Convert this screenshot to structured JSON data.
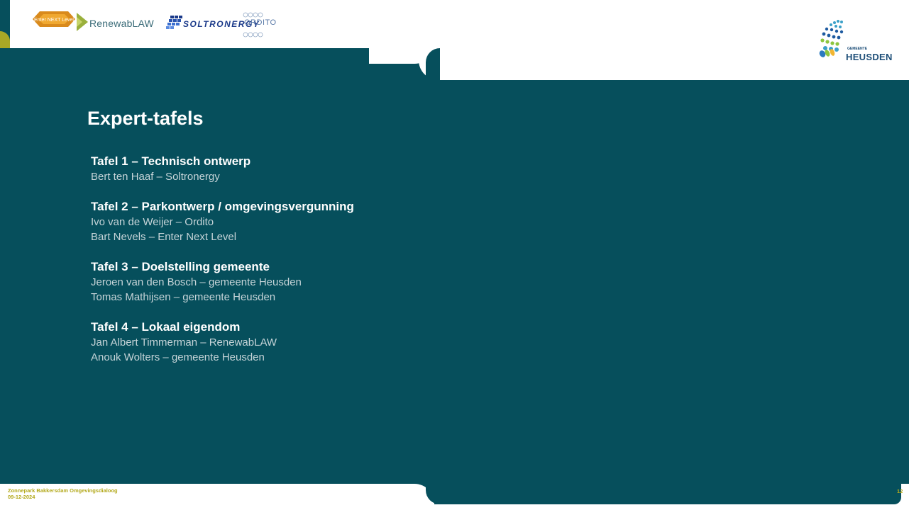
{
  "header": {
    "logos": {
      "enter_next_level": "Enter NEXT Level",
      "renewablaw": "RenewabLAW",
      "soltronergy": "SOLTRONERGY",
      "ordito": "ORDITO",
      "gemeente_small": "GEMEENTE",
      "heusden": "HEUSDEN"
    }
  },
  "slide": {
    "title": "Expert-tafels",
    "tables": [
      {
        "heading": "Tafel 1 – Technisch ontwerp",
        "people": [
          "Bert ten Haaf – Soltronergy"
        ]
      },
      {
        "heading": "Tafel 2 – Parkontwerp / omgevingsvergunning",
        "people": [
          "Ivo van de Weijer – Ordito",
          "Bart Nevels – Enter Next Level"
        ]
      },
      {
        "heading": "Tafel 3 – Doelstelling gemeente",
        "people": [
          "Jeroen van den Bosch – gemeente Heusden",
          "Tomas Mathijsen – gemeente Heusden"
        ]
      },
      {
        "heading": "Tafel 4 – Lokaal eigendom",
        "people": [
          "Jan Albert Timmerman – RenewabLAW",
          "Anouk Wolters – gemeente Heusden"
        ]
      }
    ]
  },
  "footer": {
    "line1": "Zonnepark Bakkersdam Omgevingsdialoog",
    "line2": "09-12-2024",
    "page_number": "12"
  },
  "colors": {
    "background_teal": "#064f5c",
    "footer_olive": "#b3a91c",
    "accent_olive": "#a9a826"
  }
}
